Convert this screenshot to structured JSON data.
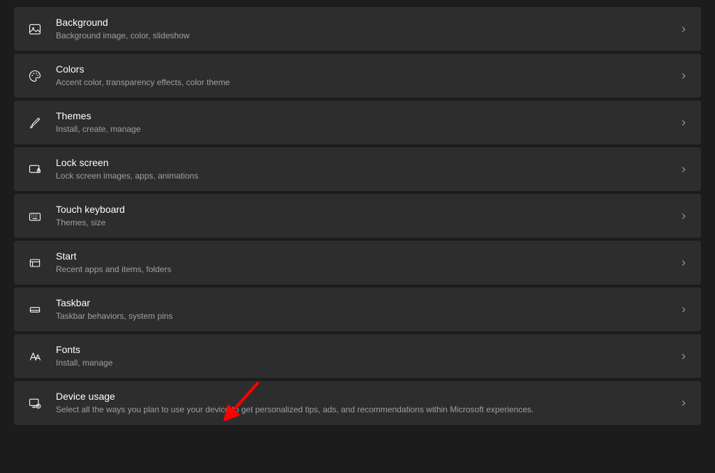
{
  "items": [
    {
      "key": "background",
      "title": "Background",
      "subtitle": "Background image, color, slideshow",
      "icon": "image-icon"
    },
    {
      "key": "colors",
      "title": "Colors",
      "subtitle": "Accent color, transparency effects, color theme",
      "icon": "palette-icon"
    },
    {
      "key": "themes",
      "title": "Themes",
      "subtitle": "Install, create, manage",
      "icon": "brush-icon"
    },
    {
      "key": "lock-screen",
      "title": "Lock screen",
      "subtitle": "Lock screen images, apps, animations",
      "icon": "lock-screen-icon"
    },
    {
      "key": "touch-keyboard",
      "title": "Touch keyboard",
      "subtitle": "Themes, size",
      "icon": "keyboard-icon"
    },
    {
      "key": "start",
      "title": "Start",
      "subtitle": "Recent apps and items, folders",
      "icon": "start-icon"
    },
    {
      "key": "taskbar",
      "title": "Taskbar",
      "subtitle": "Taskbar behaviors, system pins",
      "icon": "taskbar-icon"
    },
    {
      "key": "fonts",
      "title": "Fonts",
      "subtitle": "Install, manage",
      "icon": "fonts-icon"
    },
    {
      "key": "device-usage",
      "title": "Device usage",
      "subtitle": "Select all the ways you plan to use your device to get personalized tips, ads, and recommendations within Microsoft experiences.",
      "icon": "device-usage-icon"
    }
  ]
}
